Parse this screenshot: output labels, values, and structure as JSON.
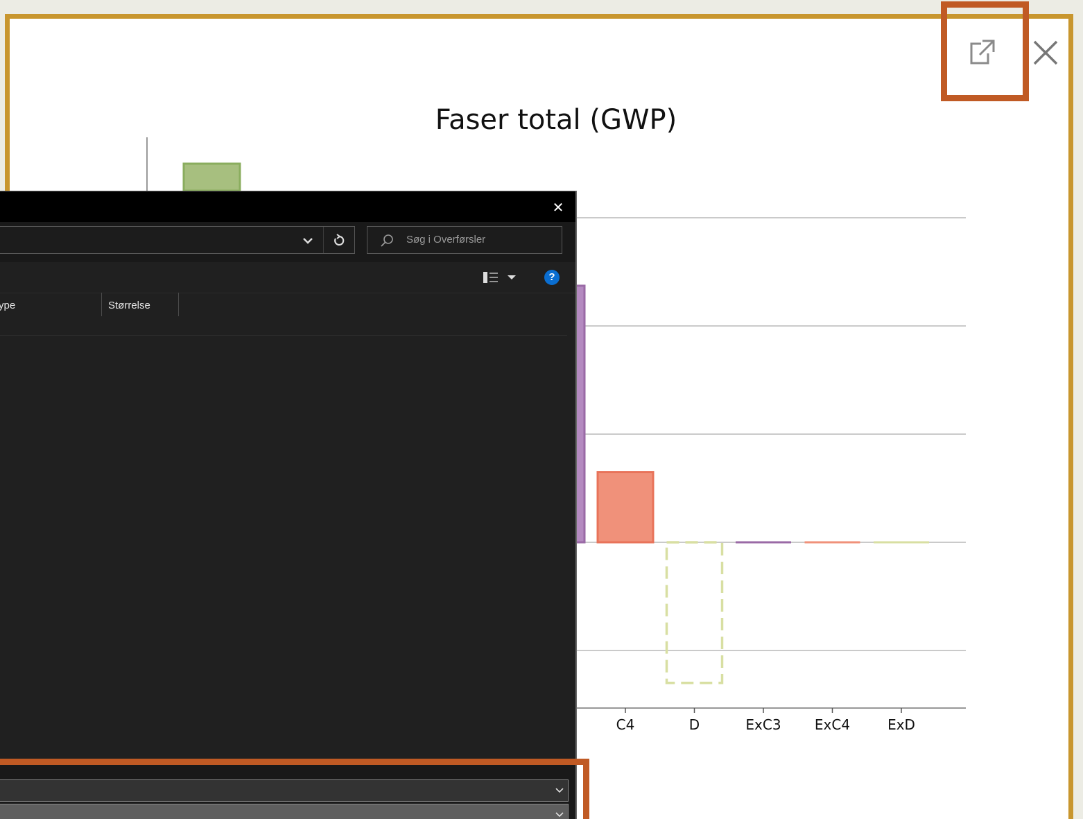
{
  "chart": {
    "title": "Faser total (GWP)",
    "popout_icon": "popout-icon",
    "close_icon": "close-icon"
  },
  "chart_data": {
    "type": "bar",
    "title": "Faser total (GWP)",
    "categories": [
      "C4",
      "D",
      "ExC3",
      "ExC4",
      "ExD"
    ],
    "values": [
      0.65,
      -1.3,
      0,
      0,
      0
    ],
    "styles": [
      "solid",
      "dashed",
      "solid",
      "solid",
      "dashed"
    ],
    "colors": [
      "#f0917a",
      "#d8dfa2",
      "#9a6aa6",
      "#f0917a",
      "#d8dfa2"
    ],
    "grid": true
  },
  "dialog": {
    "close_label": "✕",
    "search_placeholder": "Søg i Overførsler",
    "columns": [
      "ype",
      "Størrelse"
    ],
    "help_label": "?",
    "view_icon": "view-options-icon"
  }
}
